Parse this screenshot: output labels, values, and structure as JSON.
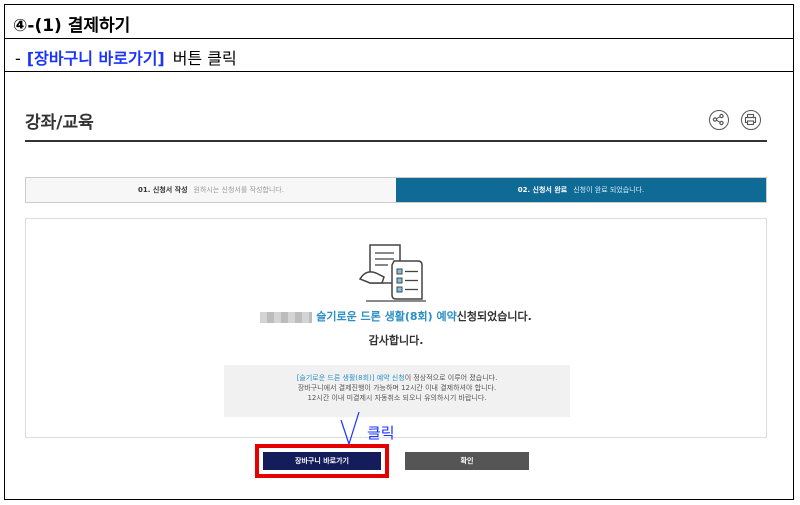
{
  "instruction": {
    "step_title": "④-(1) 결제하기",
    "dash": "-",
    "highlight": "[장바구니 바로가기]",
    "action": "버튼 클릭"
  },
  "page": {
    "title": "강좌/교육"
  },
  "steps": [
    {
      "number": "01. 신청서 작성",
      "desc": "원하시는 신청서를 작성합니다."
    },
    {
      "number": "02. 신청서 완료",
      "desc": "신청이 완료 되었습니다."
    }
  ],
  "result": {
    "course_name": "슬기로운 드론 생활(8회) 예약",
    "message_suffix": "신청되었습니다.",
    "thanks": "감사합니다.",
    "notice_link": "[슬기로운 드론 생활(8회)] 예약 신청",
    "notice_line1_suffix": "이 정상적으로 이루어 졌습니다.",
    "notice_line2": "장바구니에서 결제진행이 가능하며 12시간 이내 결제하셔야 합니다.",
    "notice_line3": "12시간 이내 미결제시 자동취소 되오니 유의하시기 바랍니다."
  },
  "buttons": {
    "cart": "장바구니 바로가기",
    "ok": "확인"
  },
  "annotation": {
    "click_label": "클릭"
  },
  "colors": {
    "highlight_blue": "#1a33ff",
    "step_active": "#0f6a96",
    "cart_button": "#141d5c",
    "callout_red": "#e60000"
  }
}
